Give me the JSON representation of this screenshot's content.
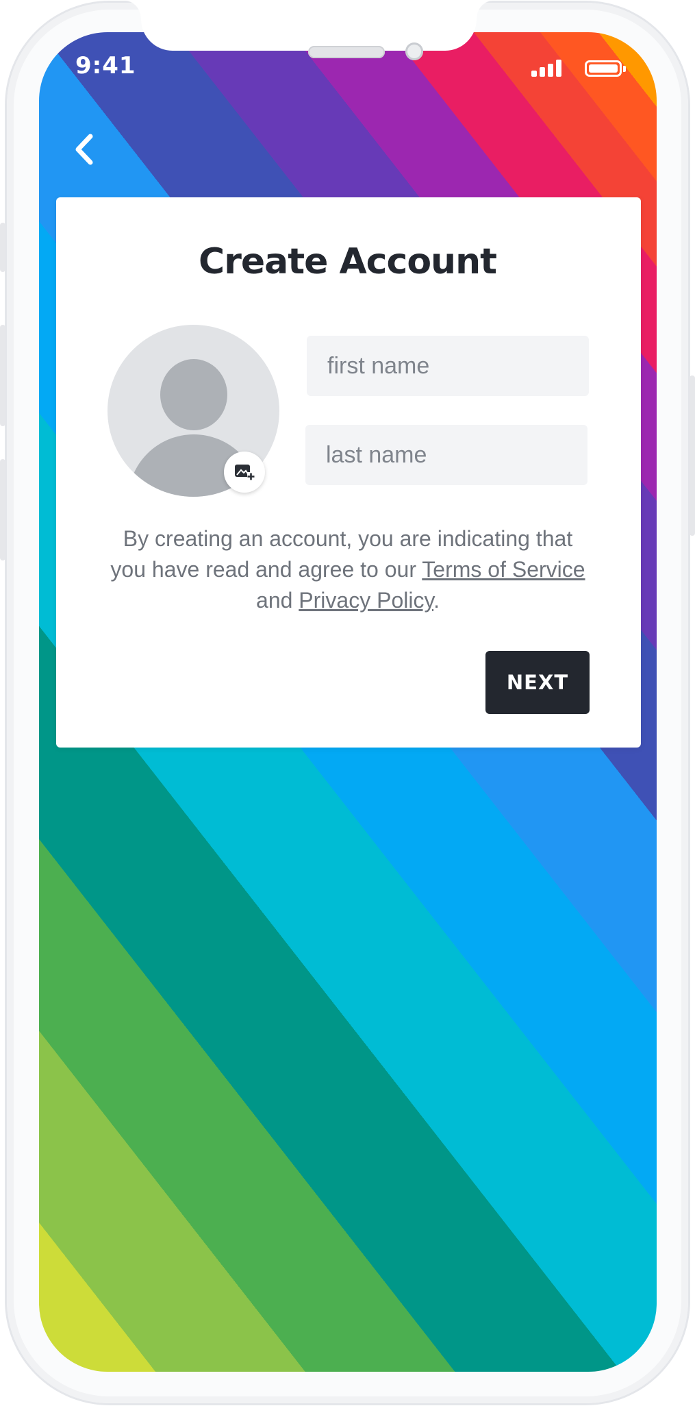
{
  "status_bar": {
    "time": "9:41",
    "signal_icon": "signal-bars-icon",
    "battery_icon": "battery-icon"
  },
  "navigation": {
    "back_icon": "chevron-left-icon"
  },
  "card": {
    "title": "Create Account",
    "avatar_icon": "user-placeholder-icon",
    "add_photo_icon": "add-photo-icon",
    "first_name_placeholder": "first name",
    "last_name_placeholder": "last name",
    "legal": {
      "prefix": "By creating an account, you are indicating that you have read and agree to our ",
      "terms_link": "Terms of Service",
      "middle": " and ",
      "privacy_link": "Privacy Policy",
      "suffix": "."
    },
    "next_label": "NEXT"
  },
  "colors": {
    "card_background": "#ffffff",
    "title_color": "#23272f",
    "button_background": "#23272f",
    "input_background": "#f3f4f6",
    "avatar_background": "#e1e3e6",
    "avatar_figure": "#adb1b6",
    "rainbow_stripes": [
      "#cddc39",
      "#8bc34a",
      "#4caf50",
      "#009688",
      "#00bcd4",
      "#03a9f4",
      "#2196f3",
      "#3f51b5",
      "#673ab7",
      "#9c27b0",
      "#e91e63",
      "#f44336",
      "#ff5722",
      "#ff9800",
      "#ffc107"
    ]
  }
}
